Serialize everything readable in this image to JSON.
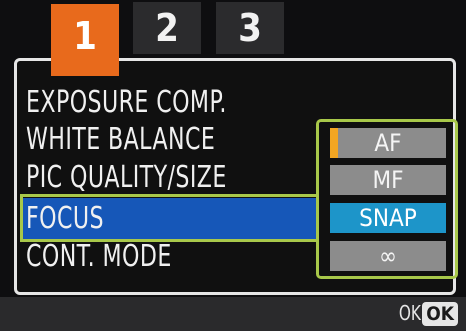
{
  "tabs": [
    {
      "label": "1",
      "active": true
    },
    {
      "label": "2",
      "active": false
    },
    {
      "label": "3",
      "active": false
    }
  ],
  "menu": {
    "items": [
      {
        "label": "EXPOSURE COMP."
      },
      {
        "label": "WHITE BALANCE"
      },
      {
        "label": "PIC QUALITY/SIZE"
      },
      {
        "label": "FOCUS",
        "selected": true
      },
      {
        "label": "CONT. MODE"
      }
    ]
  },
  "focus_options": [
    {
      "label": "AF"
    },
    {
      "label": "MF"
    },
    {
      "label": "SNAP",
      "selected": true
    },
    {
      "label": "∞"
    }
  ],
  "footer": {
    "ok_label": "OK",
    "ok_button_label": "OK"
  },
  "colors": {
    "active_tab": "#e86a1c",
    "menu_highlight": "#1657b8",
    "option_selected": "#1d95c9",
    "option_frame": "#a8c84a",
    "af_marker": "#f2a623"
  }
}
